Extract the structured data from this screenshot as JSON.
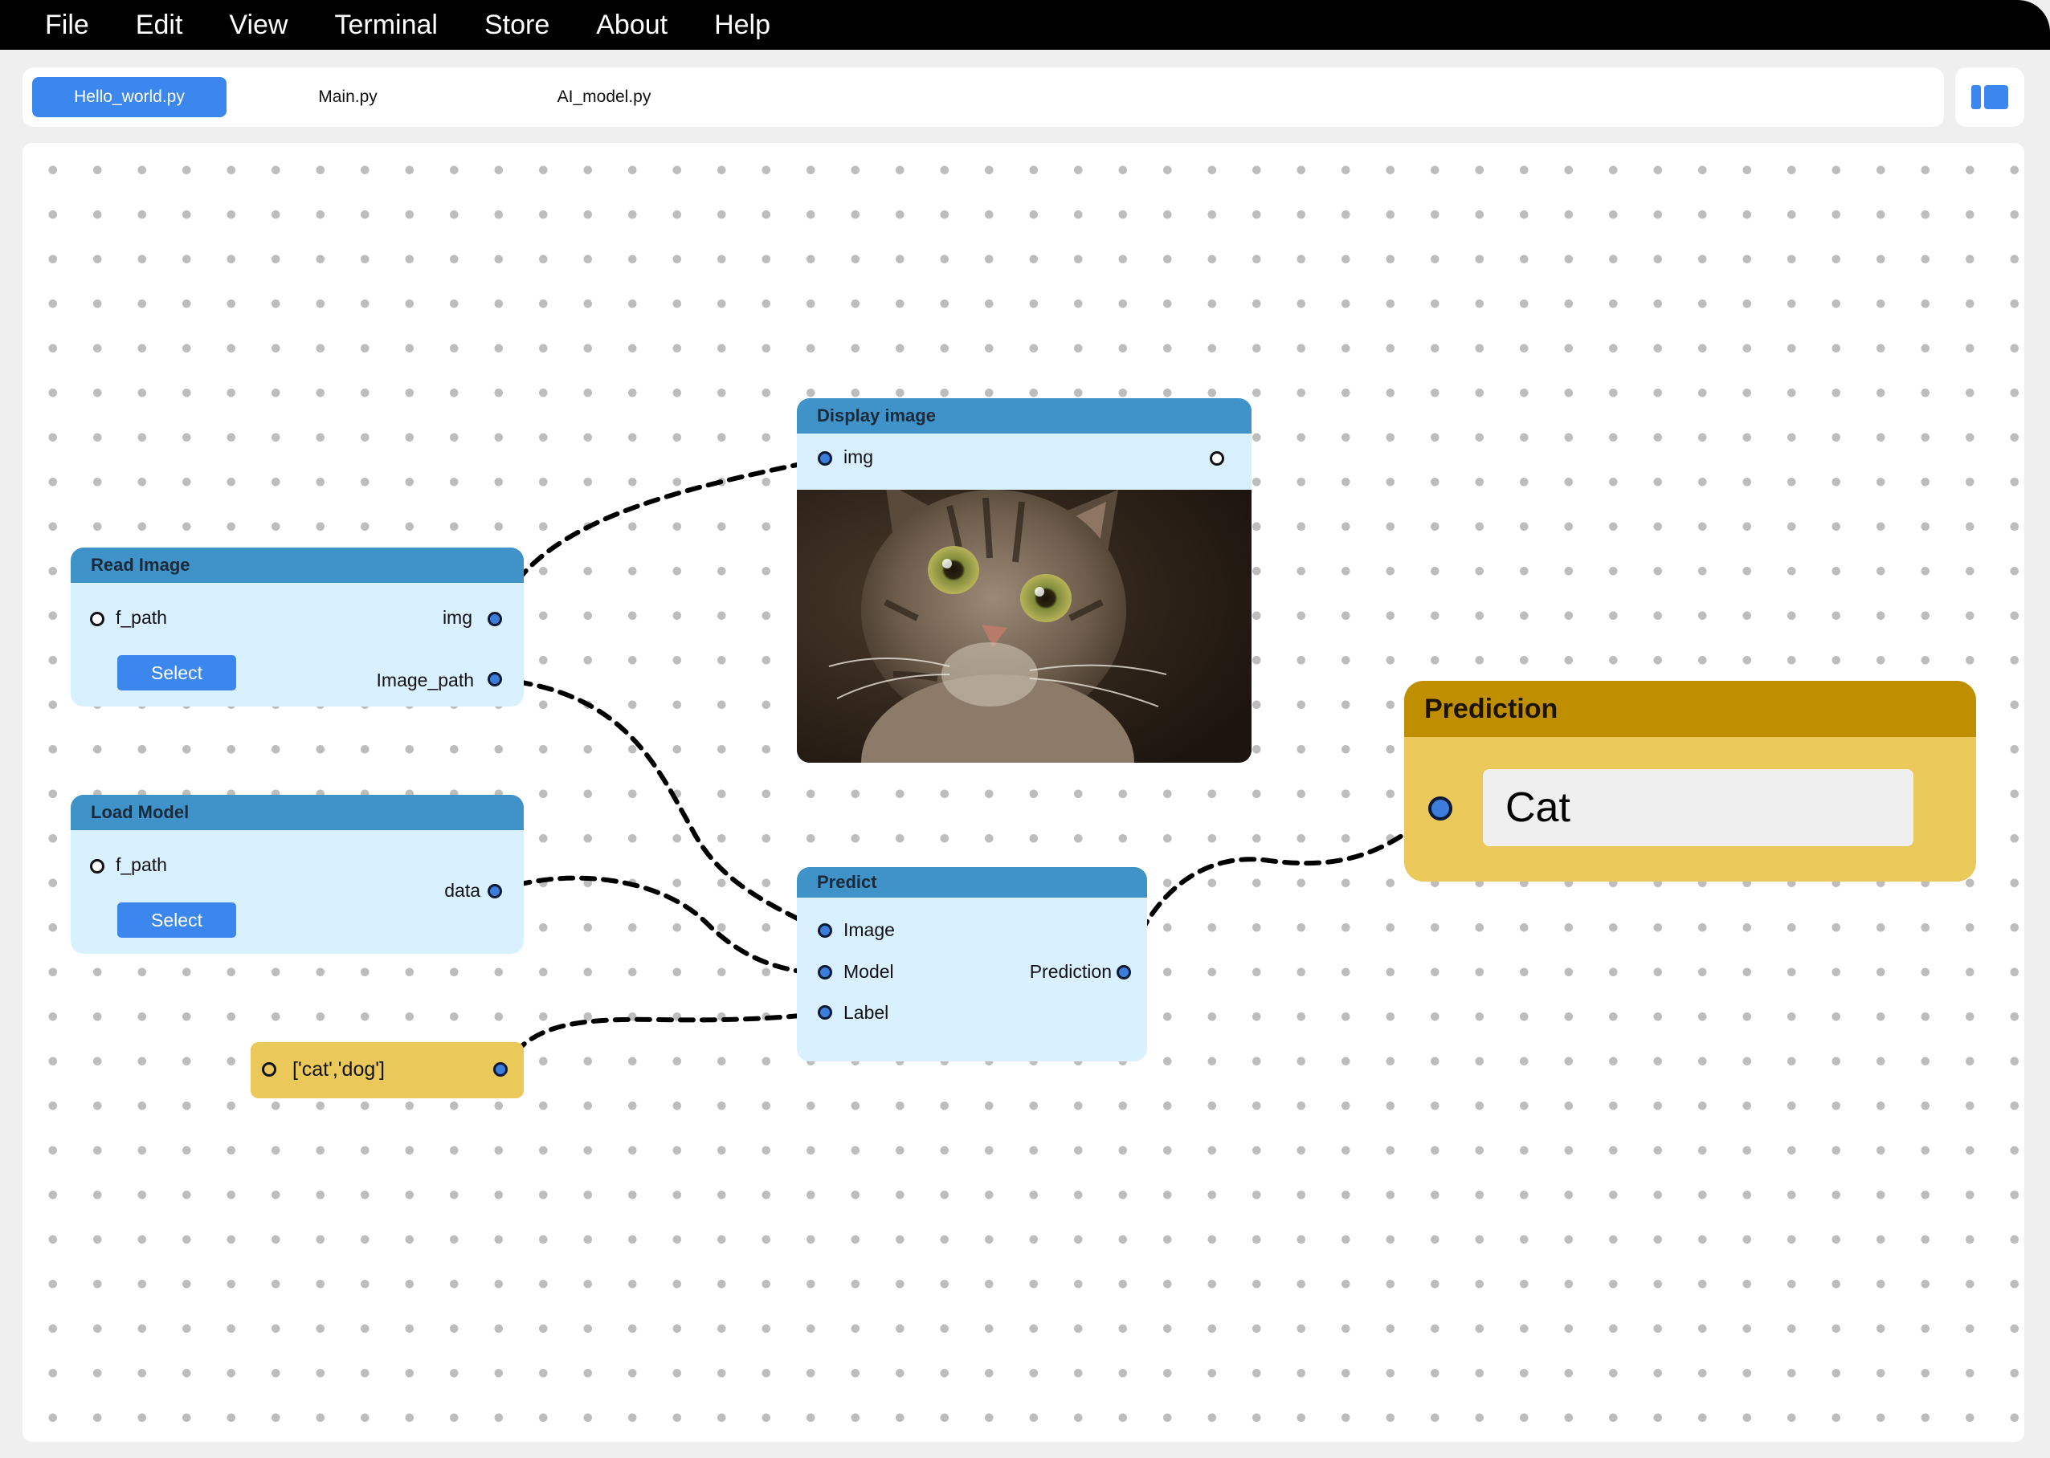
{
  "menu": [
    "File",
    "Edit",
    "View",
    "Terminal",
    "Store",
    "About",
    "Help"
  ],
  "tabs": [
    {
      "label": "Hello_world.py",
      "active": true
    },
    {
      "label": "Main.py",
      "active": false
    },
    {
      "label": "AI_model.py",
      "active": false
    }
  ],
  "nodes": {
    "read_image": {
      "title": "Read Image",
      "input": "f_path",
      "outputs": [
        "img",
        "Image_path"
      ],
      "button": "Select"
    },
    "load_model": {
      "title": "Load Model",
      "input": "f_path",
      "output": "data",
      "button": "Select"
    },
    "display_image": {
      "title": "Display image",
      "input": "img"
    },
    "predict": {
      "title": "Predict",
      "inputs": [
        "Image",
        "Model",
        "Label"
      ],
      "output": "Prediction"
    },
    "labels_const": {
      "value": "['cat','dog']"
    },
    "prediction": {
      "title": "Prediction",
      "value": "Cat"
    }
  },
  "colors": {
    "accent": "#3c87ee",
    "node_header": "#3f93c9",
    "node_body": "#d8f0ff",
    "const_node": "#ebc85a",
    "prediction_header": "#bf8f00"
  }
}
